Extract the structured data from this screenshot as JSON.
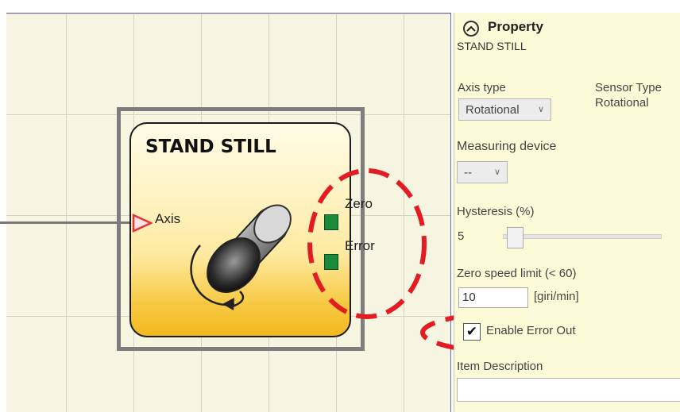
{
  "block": {
    "title": "STAND STILL",
    "input_label": "Axis",
    "outputs": [
      "Zero",
      "Error"
    ]
  },
  "panel": {
    "header": "Property",
    "subtitle": "STAND STILL",
    "axis_type_label": "Axis type",
    "axis_type_value": "Rotational",
    "sensor_type_label": "Sensor Type",
    "sensor_type_value": "Rotational",
    "measuring_device_label": "Measuring device",
    "measuring_device_value": "--",
    "hysteresis_label": "Hysteresis (%)",
    "hysteresis_value": "5",
    "hysteresis_slider_level": 0.05,
    "zero_speed_label": "Zero speed limit  (< 60)",
    "zero_speed_value": "10",
    "zero_speed_unit": "[giri/min]",
    "enable_error_out_label": "Enable Error Out",
    "enable_error_out_checked": true,
    "item_description_label": "Item Description",
    "item_description_value": ""
  },
  "icons": {
    "collapse": "chevron-up-circle-icon",
    "dropdown": "chevron-down-icon",
    "check": "check-icon",
    "input_pin": "triangle-right-icon",
    "cylinder": "rotating-cylinder-icon"
  },
  "colors": {
    "canvas_bg": "#f6f5e2",
    "panel_bg": "#fbfbd8",
    "output_pin": "#1a8a3a",
    "input_pin": "#e8323c",
    "annotation": "#e31b23",
    "block_gradient_bottom": "#f2b91e"
  }
}
